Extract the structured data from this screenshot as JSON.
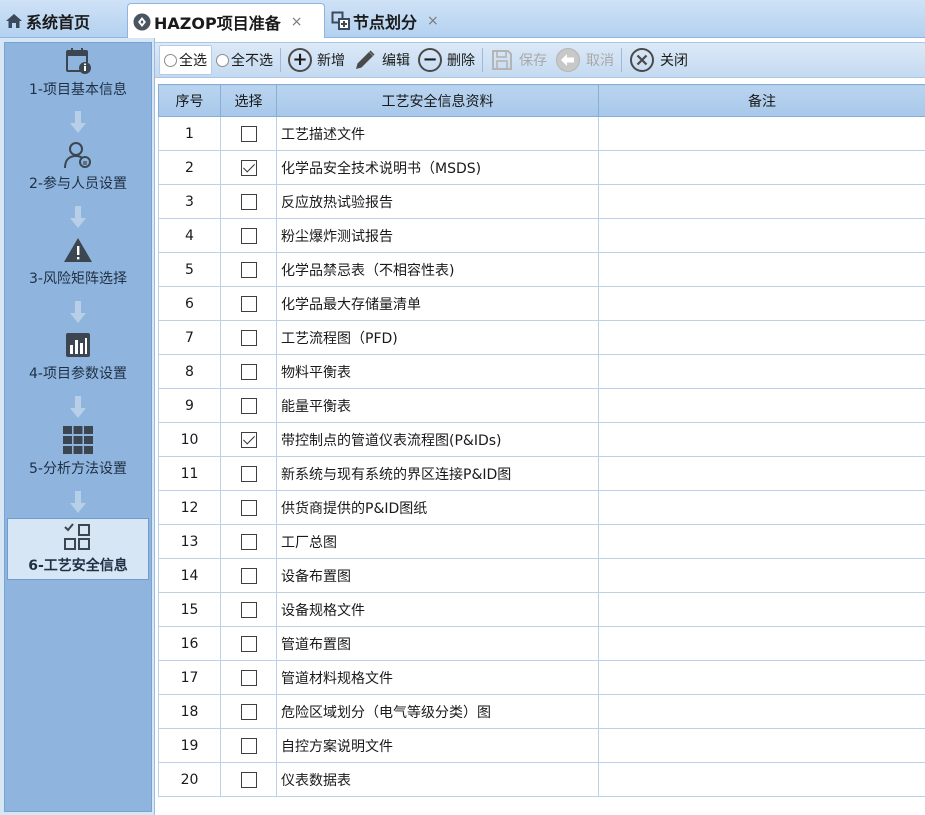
{
  "tabs": {
    "home": "系统首页",
    "active": "HAZOP项目准备",
    "node": "节点划分",
    "close_glyph": "×"
  },
  "sidebar": {
    "steps": [
      {
        "label": "1-项目基本信息",
        "icon": "calendar-info-icon"
      },
      {
        "label": "2-参与人员设置",
        "icon": "person-icon"
      },
      {
        "label": "3-风险矩阵选择",
        "icon": "warning-icon"
      },
      {
        "label": "4-项目参数设置",
        "icon": "bar-chart-icon"
      },
      {
        "label": "5-分析方法设置",
        "icon": "grid-icon"
      },
      {
        "label": "6-工艺安全信息",
        "icon": "process-safety-icon"
      }
    ],
    "active_index": 5
  },
  "toolbar": {
    "select_all": "全选",
    "select_none": "全不选",
    "add": "新增",
    "edit": "编辑",
    "delete": "删除",
    "save": "保存",
    "cancel": "取消",
    "close": "关闭"
  },
  "grid": {
    "headers": {
      "no": "序号",
      "select": "选择",
      "name": "工艺安全信息资料",
      "remark": "备注"
    },
    "rows": [
      {
        "no": "1",
        "checked": false,
        "name": "工艺描述文件",
        "remark": ""
      },
      {
        "no": "2",
        "checked": true,
        "name": "化学品安全技术说明书（MSDS)",
        "remark": ""
      },
      {
        "no": "3",
        "checked": false,
        "name": "反应放热试验报告",
        "remark": ""
      },
      {
        "no": "4",
        "checked": false,
        "name": "粉尘爆炸测试报告",
        "remark": ""
      },
      {
        "no": "5",
        "checked": false,
        "name": "化学品禁忌表（不相容性表)",
        "remark": ""
      },
      {
        "no": "6",
        "checked": false,
        "name": "化学品最大存储量清单",
        "remark": ""
      },
      {
        "no": "7",
        "checked": false,
        "name": "工艺流程图（PFD)",
        "remark": ""
      },
      {
        "no": "8",
        "checked": false,
        "name": "物料平衡表",
        "remark": ""
      },
      {
        "no": "9",
        "checked": false,
        "name": "能量平衡表",
        "remark": ""
      },
      {
        "no": "10",
        "checked": true,
        "name": "带控制点的管道仪表流程图(P&IDs)",
        "remark": ""
      },
      {
        "no": "11",
        "checked": false,
        "name": "新系统与现有系统的界区连接P&ID图",
        "remark": ""
      },
      {
        "no": "12",
        "checked": false,
        "name": "供货商提供的P&ID图纸",
        "remark": ""
      },
      {
        "no": "13",
        "checked": false,
        "name": "工厂总图",
        "remark": ""
      },
      {
        "no": "14",
        "checked": false,
        "name": "设备布置图",
        "remark": ""
      },
      {
        "no": "15",
        "checked": false,
        "name": "设备规格文件",
        "remark": ""
      },
      {
        "no": "16",
        "checked": false,
        "name": "管道布置图",
        "remark": ""
      },
      {
        "no": "17",
        "checked": false,
        "name": "管道材料规格文件",
        "remark": ""
      },
      {
        "no": "18",
        "checked": false,
        "name": "危险区域划分（电气等级分类）图",
        "remark": ""
      },
      {
        "no": "19",
        "checked": false,
        "name": "自控方案说明文件",
        "remark": ""
      },
      {
        "no": "20",
        "checked": false,
        "name": "仪表数据表",
        "remark": ""
      }
    ]
  },
  "colors": {
    "sidebar_bg": "#8fb5de",
    "header_bg": "#a8c8ea",
    "tabbar_bg": "#b3d1f0"
  }
}
